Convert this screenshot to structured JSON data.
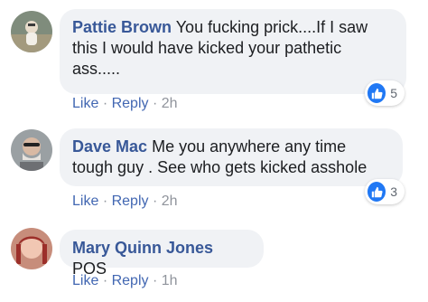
{
  "comments": [
    {
      "author": "Pattie Brown",
      "text": "You fucking prick....If I saw this I would have kicked your pathetic ass.....",
      "line1": "You fucking prick....If I saw",
      "line2": "this I would have kicked your pathetic",
      "line3": "ass.....",
      "like_label": "Like",
      "reply_label": "Reply",
      "separator": "·",
      "time": "2h",
      "reaction_count": "5",
      "reaction_icon": "thumbs-up-icon",
      "avatar_colors": [
        "#7a8a8e",
        "#c9b08a"
      ]
    },
    {
      "author": "Dave Mac",
      "text": "Me you anywhere any time tough guy . See who gets kicked asshole",
      "line1": "Me you anywhere any time",
      "line2": "tough guy . See who gets kicked asshole",
      "like_label": "Like",
      "reply_label": "Reply",
      "separator": "·",
      "time": "2h",
      "reaction_count": "3",
      "reaction_icon": "thumbs-up-icon",
      "avatar_colors": [
        "#8a8f94",
        "#d9d4cf"
      ]
    },
    {
      "author": "Mary Quinn Jones",
      "text": "POS",
      "line1": "POS",
      "like_label": "Like",
      "reply_label": "Reply",
      "separator": "·",
      "time": "1h",
      "avatar_colors": [
        "#b86a5a",
        "#e8b9a6"
      ]
    }
  ],
  "colors": {
    "author": "#385898",
    "action_link": "#4267b2",
    "bubble": "#f0f2f5",
    "like_badge": "#2078f4"
  }
}
